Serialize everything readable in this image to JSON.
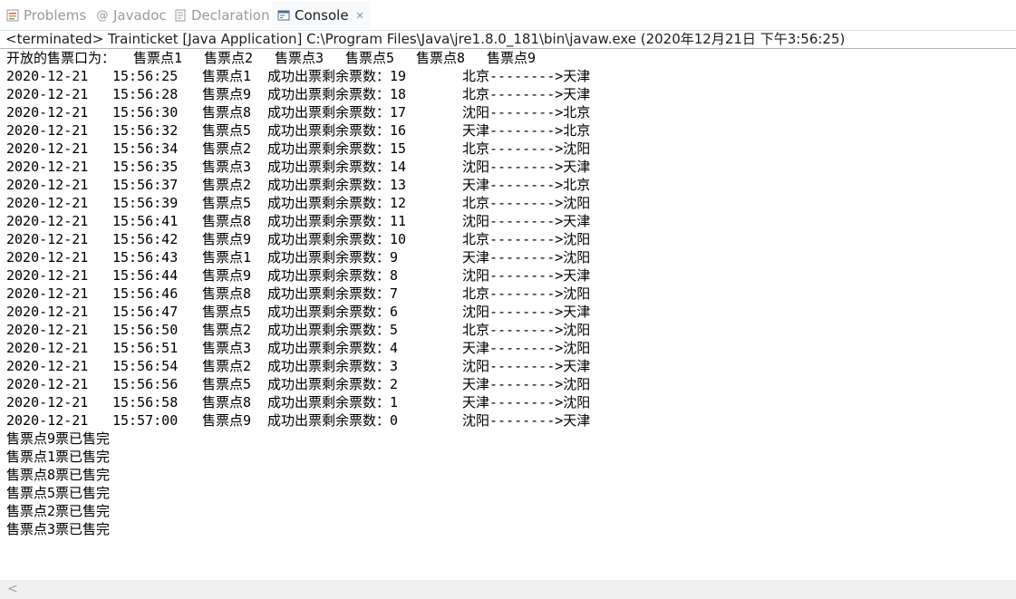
{
  "tabs": [
    {
      "label": "Problems",
      "icon": "problems-icon"
    },
    {
      "label": "Javadoc",
      "icon": "javadoc-icon"
    },
    {
      "label": "Declaration",
      "icon": "declaration-icon"
    },
    {
      "label": "Console",
      "icon": "console-icon",
      "close": "✕"
    }
  ],
  "status": "<terminated> Trainticket [Java Application] C:\\Program Files\\Java\\jre1.8.0_181\\bin\\javaw.exe (2020年12月21日 下午3:56:25)",
  "console": {
    "header_label": "开放的售票口为：",
    "header_points": [
      "售票点1",
      "售票点2",
      "售票点3",
      "售票点5",
      "售票点8",
      "售票点9"
    ],
    "entries": [
      {
        "date": "2020-12-21",
        "time": "15:56:25",
        "point": "售票点1",
        "msg": "成功出票剩余票数：19",
        "route": "北京-------->天津"
      },
      {
        "date": "2020-12-21",
        "time": "15:56:28",
        "point": "售票点9",
        "msg": "成功出票剩余票数：18",
        "route": "北京-------->天津"
      },
      {
        "date": "2020-12-21",
        "time": "15:56:30",
        "point": "售票点8",
        "msg": "成功出票剩余票数：17",
        "route": "沈阳-------->北京"
      },
      {
        "date": "2020-12-21",
        "time": "15:56:32",
        "point": "售票点5",
        "msg": "成功出票剩余票数：16",
        "route": "天津-------->北京"
      },
      {
        "date": "2020-12-21",
        "time": "15:56:34",
        "point": "售票点2",
        "msg": "成功出票剩余票数：15",
        "route": "北京-------->沈阳"
      },
      {
        "date": "2020-12-21",
        "time": "15:56:35",
        "point": "售票点3",
        "msg": "成功出票剩余票数：14",
        "route": "沈阳-------->天津"
      },
      {
        "date": "2020-12-21",
        "time": "15:56:37",
        "point": "售票点2",
        "msg": "成功出票剩余票数：13",
        "route": "天津-------->北京"
      },
      {
        "date": "2020-12-21",
        "time": "15:56:39",
        "point": "售票点5",
        "msg": "成功出票剩余票数：12",
        "route": "北京-------->沈阳"
      },
      {
        "date": "2020-12-21",
        "time": "15:56:41",
        "point": "售票点8",
        "msg": "成功出票剩余票数：11",
        "route": "沈阳-------->天津"
      },
      {
        "date": "2020-12-21",
        "time": "15:56:42",
        "point": "售票点9",
        "msg": "成功出票剩余票数：10",
        "route": "北京-------->沈阳"
      },
      {
        "date": "2020-12-21",
        "time": "15:56:43",
        "point": "售票点1",
        "msg": "成功出票剩余票数：9",
        "route": "天津-------->沈阳"
      },
      {
        "date": "2020-12-21",
        "time": "15:56:44",
        "point": "售票点9",
        "msg": "成功出票剩余票数：8",
        "route": "沈阳-------->天津"
      },
      {
        "date": "2020-12-21",
        "time": "15:56:46",
        "point": "售票点8",
        "msg": "成功出票剩余票数：7",
        "route": "北京-------->沈阳"
      },
      {
        "date": "2020-12-21",
        "time": "15:56:47",
        "point": "售票点5",
        "msg": "成功出票剩余票数：6",
        "route": "沈阳-------->天津"
      },
      {
        "date": "2020-12-21",
        "time": "15:56:50",
        "point": "售票点2",
        "msg": "成功出票剩余票数：5",
        "route": "北京-------->沈阳"
      },
      {
        "date": "2020-12-21",
        "time": "15:56:51",
        "point": "售票点3",
        "msg": "成功出票剩余票数：4",
        "route": "天津-------->沈阳"
      },
      {
        "date": "2020-12-21",
        "time": "15:56:54",
        "point": "售票点2",
        "msg": "成功出票剩余票数：3",
        "route": "沈阳-------->天津"
      },
      {
        "date": "2020-12-21",
        "time": "15:56:56",
        "point": "售票点5",
        "msg": "成功出票剩余票数：2",
        "route": "天津-------->沈阳"
      },
      {
        "date": "2020-12-21",
        "time": "15:56:58",
        "point": "售票点8",
        "msg": "成功出票剩余票数：1",
        "route": "天津-------->沈阳"
      },
      {
        "date": "2020-12-21",
        "time": "15:57:00",
        "point": "售票点9",
        "msg": "成功出票剩余票数：0",
        "route": "沈阳-------->天津"
      }
    ],
    "soldout": [
      "售票点9票已售完",
      "售票点1票已售完",
      "售票点8票已售完",
      "售票点5票已售完",
      "售票点2票已售完",
      "售票点3票已售完"
    ]
  },
  "scrollbar": {
    "left_arrow": "<"
  },
  "colors": {
    "console_text": "#000000",
    "tab_inactive": "#9a9a9a",
    "tab_active": "#1e1e1e",
    "separator": "#b4b4b4"
  }
}
